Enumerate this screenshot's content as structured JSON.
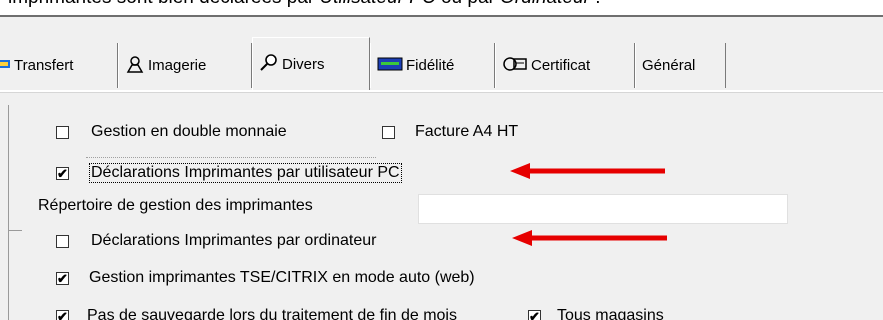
{
  "doc": {
    "part1": "imprimantes sont bien déclarées par ",
    "em1": "Utilisateur PC",
    "part2": " ou par ",
    "em2": "Ordinateur",
    "part3": " :"
  },
  "tabs": [
    {
      "label": "Transfert",
      "icon": "transfer-icon"
    },
    {
      "label": "Imagerie",
      "icon": "imaging-icon"
    },
    {
      "label": "Divers",
      "icon": "magnifier-icon"
    },
    {
      "label": "Fidélité",
      "icon": "loyalty-card-icon"
    },
    {
      "label": "Certificat",
      "icon": "certificate-icon"
    },
    {
      "label": "Général",
      "icon": ""
    }
  ],
  "options": {
    "double_monnaie": {
      "label": "Gestion en double monnaie",
      "checked": false
    },
    "facture_a4": {
      "label": "Facture A4 HT",
      "checked": false
    },
    "decl_utilisateur": {
      "label": "Déclarations Imprimantes par utilisateur PC",
      "checked": true
    },
    "repertoire_label": "Répertoire de gestion des imprimantes",
    "repertoire_value": "",
    "decl_ordinateur": {
      "label": "Déclarations Imprimantes par ordinateur",
      "checked": false
    },
    "tse_citrix": {
      "label": "Gestion imprimantes TSE/CITRIX en mode auto (web)",
      "checked": true
    },
    "pas_sauvegarde": {
      "label": "Pas de sauvegarde lors du traitement de fin de mois",
      "checked": true
    },
    "tous_magasins": {
      "label": "Tous magasins",
      "checked": true
    }
  },
  "colors": {
    "arrow": "#e60000",
    "window_bg": "#f0f0f0"
  },
  "check_glyph": "✔"
}
